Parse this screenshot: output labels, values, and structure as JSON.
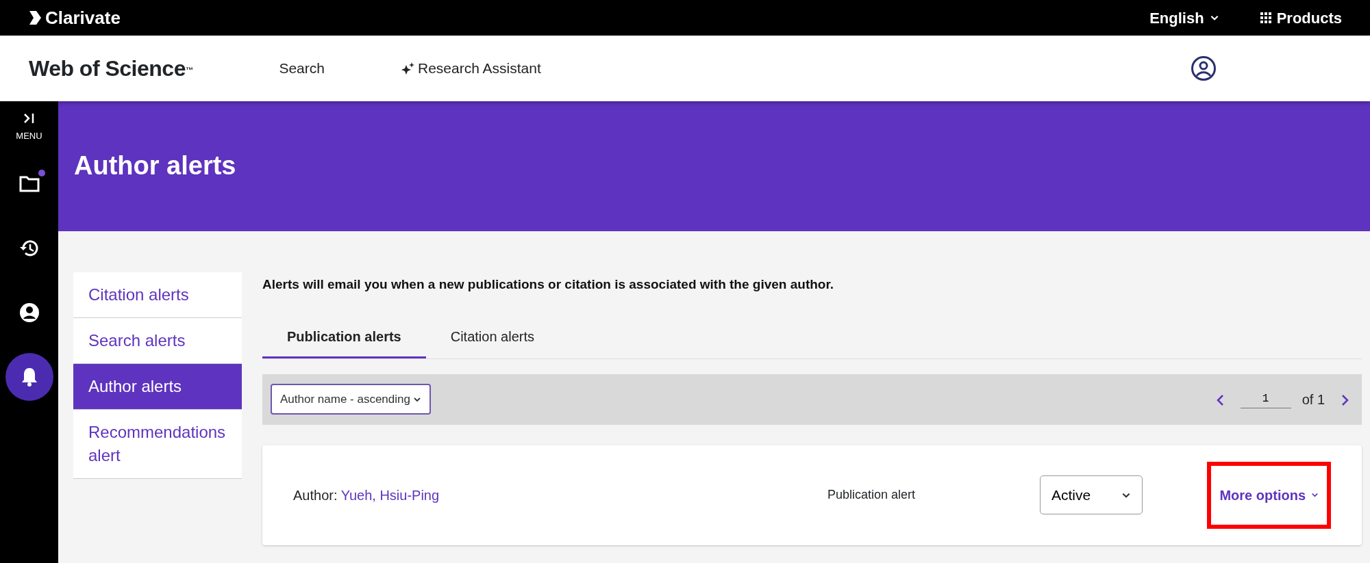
{
  "top_bar": {
    "brand": "Clarivate",
    "language": "English",
    "products": "Products"
  },
  "header": {
    "logo": "Web of Science",
    "logo_mark": "™",
    "nav": [
      {
        "label": "Search",
        "kind": "plain"
      },
      {
        "label": "Research Assistant",
        "kind": "sparkle"
      }
    ]
  },
  "rail": {
    "menu_label": "MENU",
    "items": [
      {
        "kind": "folder",
        "selected": false,
        "notification": true
      },
      {
        "kind": "history",
        "selected": false,
        "notification": false
      },
      {
        "kind": "person",
        "selected": false,
        "notification": false
      },
      {
        "kind": "bell",
        "selected": true,
        "notification": false
      }
    ]
  },
  "banner": {
    "title": "Author alerts"
  },
  "side_nav": [
    {
      "label": "Citation alerts",
      "selected": false
    },
    {
      "label": "Search alerts",
      "selected": false
    },
    {
      "label": "Author alerts",
      "selected": true
    },
    {
      "label": "Recommendations alert",
      "selected": false
    }
  ],
  "description": "Alerts will email you when a new publications or citation is associated with the given author.",
  "tabs": [
    {
      "label": "Publication alerts",
      "selected": true
    },
    {
      "label": "Citation alerts",
      "selected": false
    }
  ],
  "toolbar": {
    "sort": "Author name - ascending",
    "page": "1",
    "of": "of 1"
  },
  "alerts": [
    {
      "label": "Author:",
      "author": "Yueh, Hsiu-Ping",
      "type": "Publication alert",
      "status": "Active",
      "options": "More options",
      "highlighted": true
    }
  ]
}
